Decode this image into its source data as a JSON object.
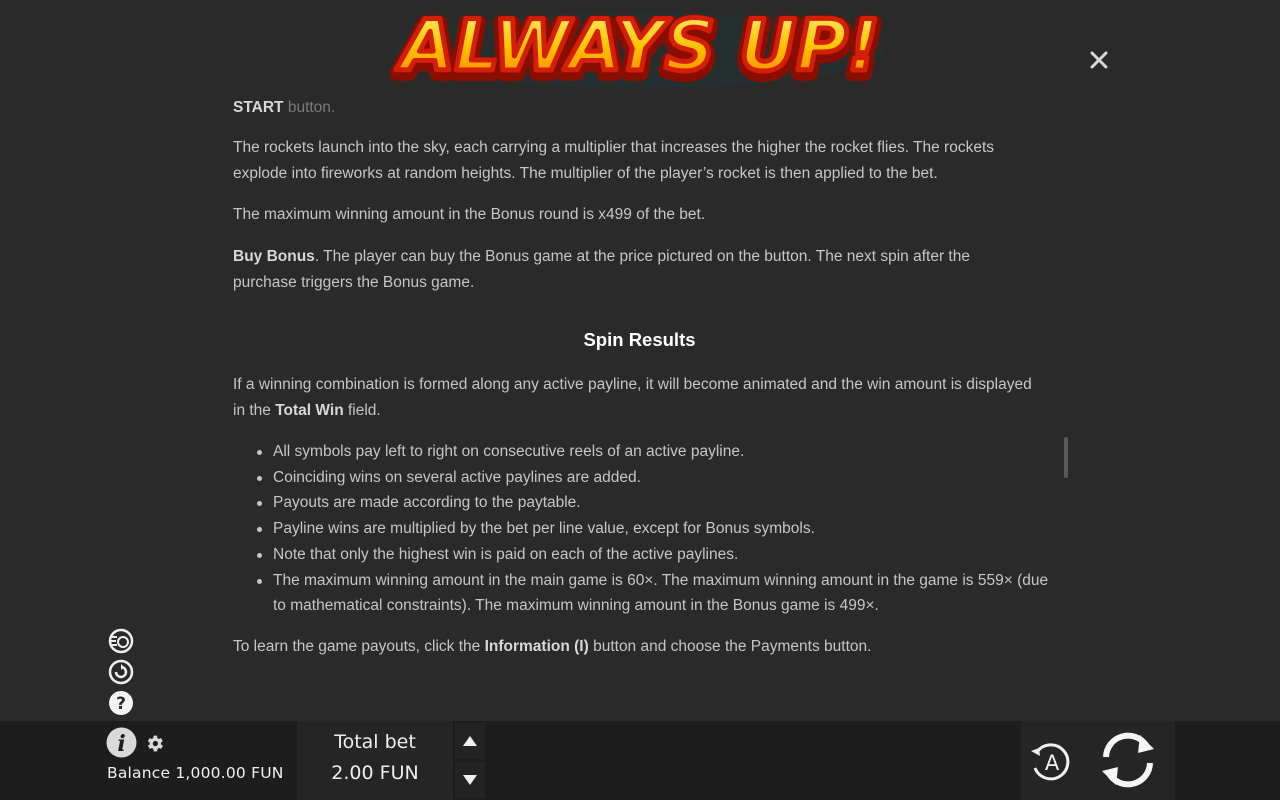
{
  "logo": {
    "text": "ALWAYS UP!"
  },
  "content": {
    "cut_line_bold": "START",
    "cut_line_rest": " button.",
    "para_rockets": "The rockets launch into the sky, each carrying a multiplier that increases the higher the rocket flies. The rockets explode into fireworks at random heights. The multiplier of the player’s rocket is then applied to the bet.",
    "para_max_bonus": "The maximum winning amount in the Bonus round is x499 of the bet.",
    "buy_bonus_bold": "Buy Bonus",
    "buy_bonus_rest": ". The player can buy the Bonus game at the price pictured on the button. The next spin after the purchase triggers the Bonus game.",
    "section_title": "Spin Results",
    "spin_intro_start": "If a winning combination is formed along any active payline, it will become animated and the win amount is displayed in the ",
    "spin_intro_bold": "Total Win",
    "spin_intro_end": " field.",
    "bullets": [
      "All symbols pay left to right on consecutive reels of an active payline.",
      "Coinciding wins on several active paylines are added.",
      "Payouts are made according to the paytable.",
      "Payline wins are multiplied by the bet per line value, except for Bonus symbols.",
      "Note that only the highest win is paid on each of the active paylines.",
      "The maximum winning amount in the main game is 60×. The maximum winning amount in the game is 559× (due to mathematical constraints). The maximum winning amount in the Bonus game is 499×."
    ],
    "payouts_start": "To learn the game payouts, click the ",
    "payouts_bold": "Information (I)",
    "payouts_end": " button and choose the Payments button."
  },
  "bottom": {
    "balance": "Balance 1,000.00 FUN",
    "total_bet_label": "Total bet",
    "total_bet_value": "2.00 FUN",
    "auto_label": "A"
  },
  "icons": {
    "close": "close-icon",
    "quick_spin": "quick-spin-icon",
    "history": "history-icon",
    "help": "help-icon",
    "info": "info-icon",
    "settings": "gear-icon",
    "bet_up": "arrow-up-icon",
    "bet_down": "arrow-down-icon",
    "autoplay": "autoplay-icon",
    "spin": "spin-icon"
  },
  "colors": {
    "background": "#2a2a2a",
    "bottom_bar": "#1d1d1d",
    "text": "#c6c6c6",
    "title": "#ffffff",
    "logo_fill": "#ffcc00",
    "logo_stroke": "#c81e0a"
  }
}
